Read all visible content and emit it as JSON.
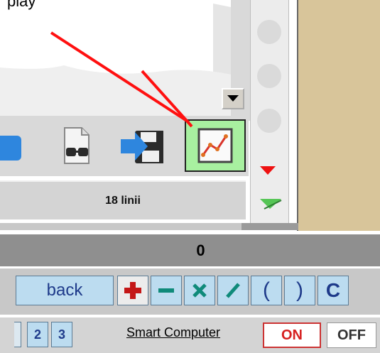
{
  "top_fragment": "play",
  "status": {
    "lines_label": "18 linii"
  },
  "calculator": {
    "display_value": "0",
    "back_label": "back",
    "open_paren": "(",
    "close_paren": ")",
    "clear_label": "C"
  },
  "bottom_bar": {
    "num_2": "2",
    "num_3": "3",
    "smart_label": "Smart Computer",
    "on_label": "ON",
    "off_label": "OFF"
  },
  "icons": {
    "toolbar": [
      "partial-icon",
      "glasses-icon",
      "save-icon",
      "chart-icon"
    ],
    "calculator_ops": [
      "plus-icon",
      "minus-icon",
      "multiply-icon",
      "divide-icon"
    ]
  },
  "colors": {
    "highlight": "#a8f0a0",
    "arrow": "#ff0000",
    "tan_panel": "#d8c59a",
    "calc_button": "#bcdcf0",
    "on_text": "#d62020"
  }
}
